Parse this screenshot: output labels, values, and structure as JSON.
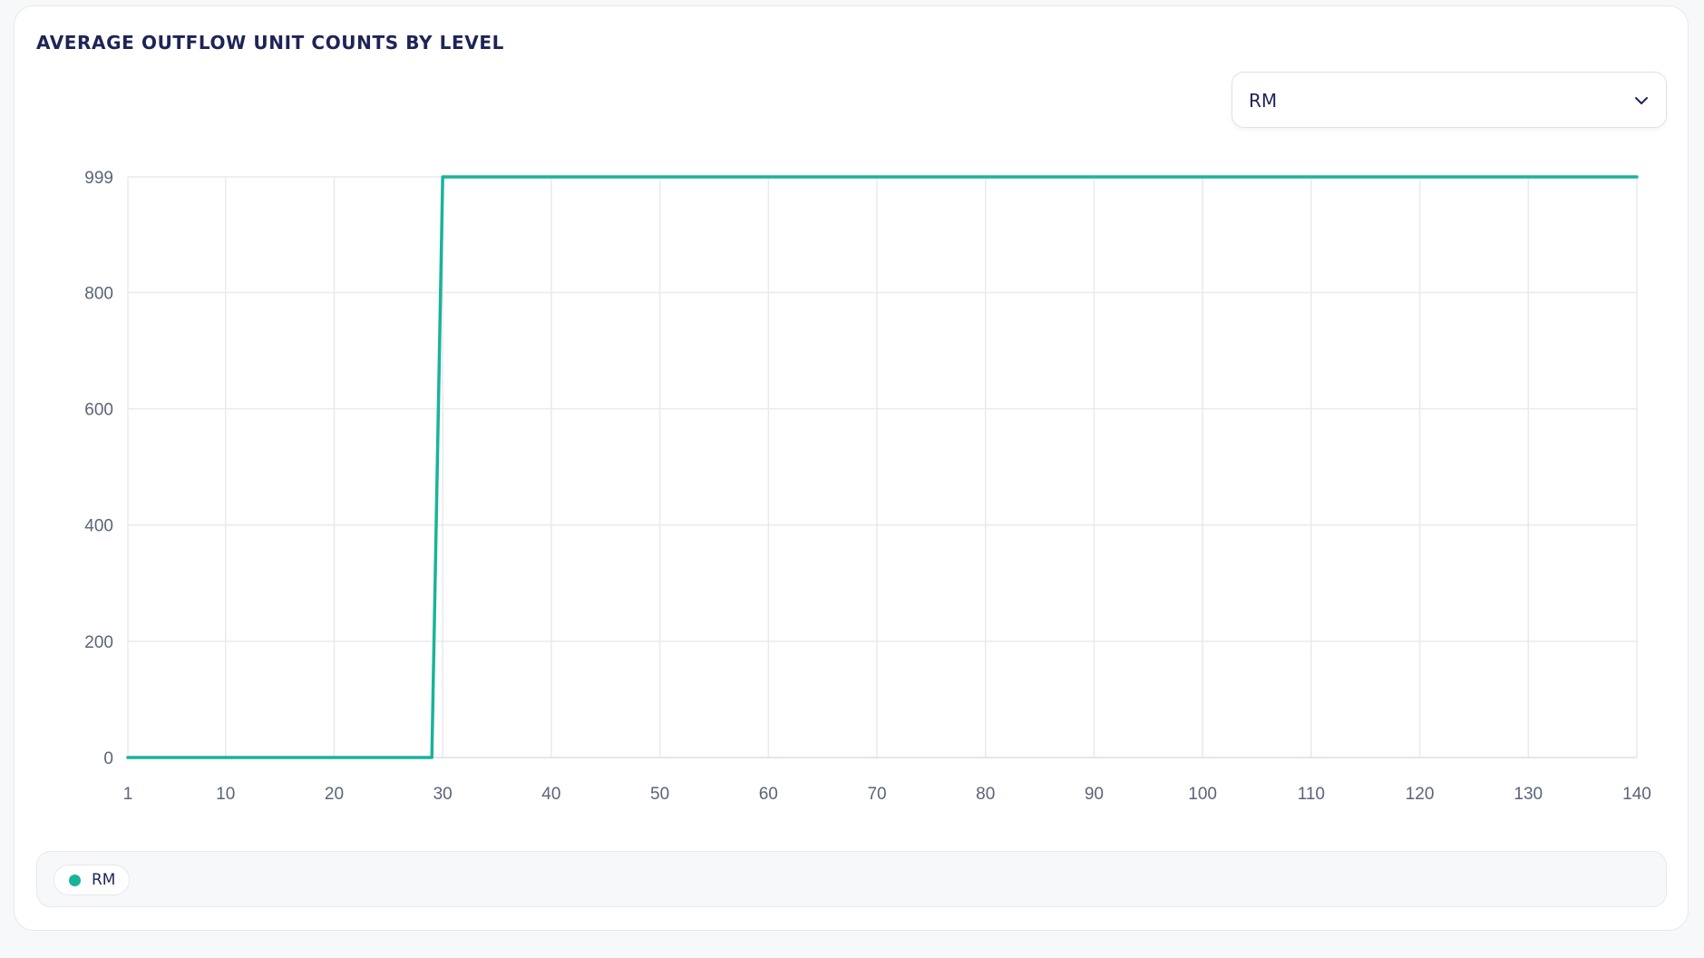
{
  "panel": {
    "title": "AVERAGE OUTFLOW UNIT COUNTS BY LEVEL"
  },
  "selector": {
    "value": "RM",
    "icon": "chevron-down-icon"
  },
  "legend": {
    "items": [
      {
        "label": "RM",
        "color": "#1ab39a"
      }
    ]
  },
  "colors": {
    "line": "#1ab39a",
    "grid": "#e8eaf0",
    "tick_text": "#5b6478",
    "title": "#1e2457"
  },
  "chart_data": {
    "type": "line",
    "title": "AVERAGE OUTFLOW UNIT COUNTS BY LEVEL",
    "xlabel": "",
    "ylabel": "",
    "xlim": [
      1,
      140
    ],
    "ylim": [
      0,
      999
    ],
    "x_ticks": [
      1,
      10,
      20,
      30,
      40,
      50,
      60,
      70,
      80,
      90,
      100,
      110,
      120,
      130,
      140
    ],
    "y_ticks": [
      0,
      200,
      400,
      600,
      800,
      999
    ],
    "grid": true,
    "legend_position": "bottom",
    "series": [
      {
        "name": "RM",
        "color": "#1ab39a",
        "x": [
          1,
          29,
          30,
          140
        ],
        "y": [
          0,
          0,
          999,
          999
        ]
      }
    ]
  }
}
